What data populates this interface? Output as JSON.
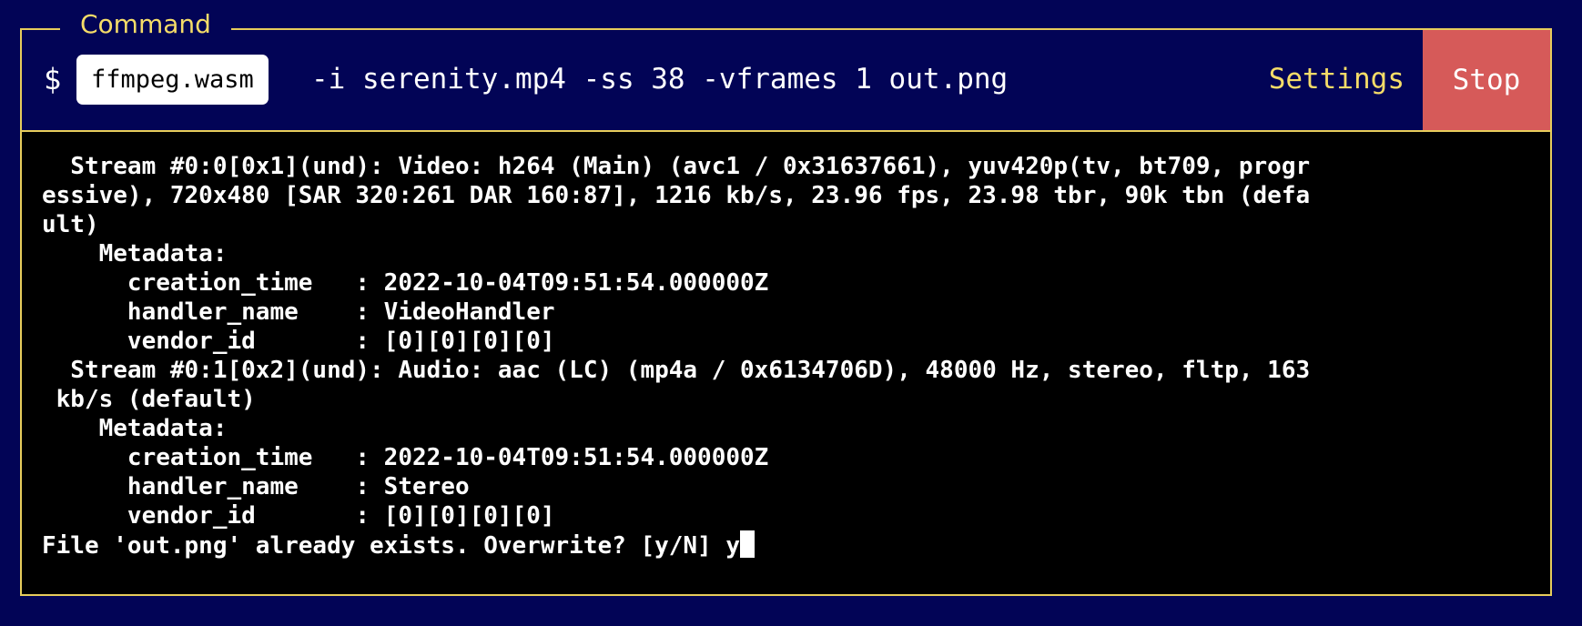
{
  "panel": {
    "legend": "Command"
  },
  "command": {
    "prompt_symbol": "$",
    "program": "ffmpeg.wasm",
    "args": "-i serenity.mp4 -ss 38 -vframes 1 out.png",
    "settings_label": "Settings",
    "stop_label": "Stop"
  },
  "terminal": {
    "lines": [
      "  Stream #0:0[0x1](und): Video: h264 (Main) (avc1 / 0x31637661), yuv420p(tv, bt709, progr",
      "essive), 720x480 [SAR 320:261 DAR 160:87], 1216 kb/s, 23.96 fps, 23.98 tbr, 90k tbn (defa",
      "ult)",
      "    Metadata:",
      "      creation_time   : 2022-10-04T09:51:54.000000Z",
      "      handler_name    : VideoHandler",
      "      vendor_id       : [0][0][0][0]",
      "  Stream #0:1[0x2](und): Audio: aac (LC) (mp4a / 0x6134706D), 48000 Hz, stereo, fltp, 163",
      " kb/s (default)",
      "    Metadata:",
      "      creation_time   : 2022-10-04T09:51:54.000000Z",
      "      handler_name    : Stereo",
      "      vendor_id       : [0][0][0][0]",
      "File 'out.png' already exists. Overwrite? [y/N] y"
    ]
  },
  "colors": {
    "background": "#020456",
    "accent": "#f5dc68",
    "stop_button": "#d65a59",
    "terminal_bg": "#000000"
  }
}
